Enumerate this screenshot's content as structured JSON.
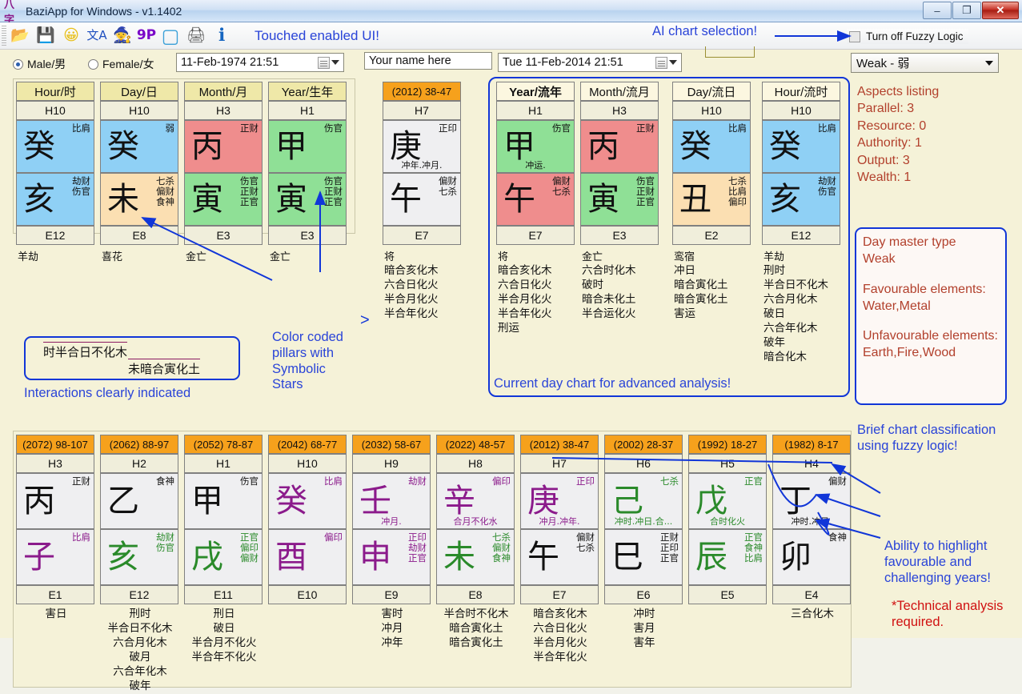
{
  "window": {
    "title": "BaziApp for Windows - v1.1402",
    "app_icon": "bazi-logo-icon",
    "minimize": "–",
    "maximize": "❐",
    "close": "✕"
  },
  "toolbar": {
    "icons": [
      {
        "name": "open-folder-icon",
        "glyph": "📂"
      },
      {
        "name": "save-icon",
        "glyph": "💾"
      },
      {
        "name": "smiley-icon",
        "glyph": "😀"
      },
      {
        "name": "translate-icon",
        "glyph": "文A"
      },
      {
        "name": "wizard-hat-icon",
        "glyph": "🧙"
      },
      {
        "name": "nine-pillars-icon",
        "glyph": "9P"
      },
      {
        "name": "new-window-icon",
        "glyph": "▢"
      },
      {
        "name": "print-icon",
        "glyph": "🖨"
      },
      {
        "name": "info-icon",
        "glyph": "ℹ"
      }
    ],
    "note": "Touched enabled UI!"
  },
  "controls": {
    "male_label": "Male/男",
    "female_label": "Female/女",
    "male_selected": true,
    "birth_datetime": "11-Feb-1974 21:51",
    "name_value": "Your name here",
    "current_datetime": "Tue  11-Feb-2014 21:51",
    "fuzzy_checkbox_label": "Turn off Fuzzy Logic",
    "fuzzy_checked": false,
    "strength_selected": "Weak - 弱",
    "ai_note": "AI chart selection!"
  },
  "natal_pillars": [
    {
      "header": "Hour/时",
      "hnum": "H10",
      "stem": "癸",
      "stem_sub": "比肩",
      "stem_bg": "blue",
      "branch": "亥",
      "branch_sub": "劫财\n伤官",
      "branch_bg": "blue",
      "enum": "E12",
      "star": "羊劫",
      "notes": ""
    },
    {
      "header": "Day/日",
      "hnum": "H10",
      "stem": "癸",
      "stem_sub": "弱",
      "stem_bg": "blue",
      "branch": "未",
      "branch_sub": "七杀\n偏财\n食神",
      "branch_bg": "peach",
      "enum": "E8",
      "star": "喜花",
      "notes": ""
    },
    {
      "header": "Month/月",
      "hnum": "H3",
      "stem": "丙",
      "stem_sub": "正财",
      "stem_bg": "red",
      "branch": "寅",
      "branch_sub": "伤官\n正财\n正官",
      "branch_bg": "green",
      "enum": "E3",
      "star": "金亡",
      "notes": ""
    },
    {
      "header": "Year/生年",
      "hnum": "H1",
      "stem": "甲",
      "stem_sub": "伤官",
      "stem_bg": "green",
      "branch": "寅",
      "branch_sub": "伤官\n正财\n正官",
      "branch_bg": "green",
      "enum": "E3",
      "star": "金亡",
      "notes": ""
    }
  ],
  "current_luck_pillar": {
    "header": "(2012) 38-47",
    "hnum": "H7",
    "stem": "庚",
    "stem_sub": "正印",
    "stem_under": "冲年.冲月.",
    "branch": "午",
    "branch_sub": "偏财\n七杀",
    "enum": "E7",
    "star": "将",
    "notes": "暗合亥化木\n六合日化火\n半合月化火\n半合年化火"
  },
  "current_day_chart": {
    "caption": "Current day chart for advanced analysis!",
    "pillars": [
      {
        "header": "Year/流年",
        "header_bold": true,
        "hnum": "H1",
        "stem": "甲",
        "stem_sub": "伤官",
        "stem_under": "冲运.",
        "stem_bg": "green",
        "branch": "午",
        "branch_sub": "偏财\n七杀",
        "branch_bg": "red",
        "enum": "E7",
        "star": "将",
        "notes": "暗合亥化木\n六合日化火\n半合月化火\n半合年化火\n刑运"
      },
      {
        "header": "Month/流月",
        "hnum": "H3",
        "stem": "丙",
        "stem_sub": "正财",
        "stem_bg": "red",
        "branch": "寅",
        "branch_sub": "伤官\n正财\n正官",
        "branch_bg": "green",
        "enum": "E3",
        "star": "金亡",
        "notes": "六合时化木\n破时\n暗合未化土\n半合运化火"
      },
      {
        "header": "Day/流日",
        "hnum": "H10",
        "stem": "癸",
        "stem_sub": "比肩",
        "stem_bg": "blue",
        "branch": "丑",
        "branch_sub": "七杀\n比肩\n偏印",
        "branch_bg": "peach",
        "enum": "E2",
        "star": "鸾宿",
        "notes": "冲日\n暗合寅化土\n暗合寅化土\n害运"
      },
      {
        "header": "Hour/流时",
        "hnum": "H10",
        "stem": "癸",
        "stem_sub": "比肩",
        "stem_bg": "blue",
        "branch": "亥",
        "branch_sub": "劫财\n伤官",
        "branch_bg": "blue",
        "enum": "E12",
        "star": "羊劫",
        "notes": "刑时\n半合日不化木\n六合月化木\n破日\n六合年化木\n破年\n暗合化木"
      }
    ]
  },
  "interaction_box": {
    "line1": "时半合日不化木",
    "line2": "未暗合寅化土",
    "caption": "Interactions clearly indicated"
  },
  "annotations": {
    "color_coded": "Color coded\npillars with\nSymbolic\nStars",
    "highlight": "Ability to highlight\nfavourable and\nchallenging years!",
    "technical": "*Technical analysis\nrequired.",
    "brief_classification": "Brief chart classification\nusing fuzzy logic!"
  },
  "aspects": {
    "title": "Aspects listing",
    "rows": [
      {
        "label": "Parallel",
        "value": "3"
      },
      {
        "label": "Resource",
        "value": "0"
      },
      {
        "label": "Authority",
        "value": "1"
      },
      {
        "label": "Output",
        "value": "3"
      },
      {
        "label": "Wealth",
        "value": "1"
      }
    ]
  },
  "day_master": {
    "type_label": "Day master type",
    "type_value": "Weak",
    "fav_label": "Favourable elements:",
    "fav_value": "Water,Metal",
    "unfav_label": "Unfavourable elements:",
    "unfav_value": "Earth,Fire,Wood"
  },
  "luck_pillars": [
    {
      "header": "(2072) 98-107",
      "hnum": "H3",
      "stem": "丙",
      "stem_sub": "正财",
      "stem_color": "#111111",
      "branch": "子",
      "branch_sub": "比肩",
      "branch_color": "#8b1a8b",
      "enum": "E1",
      "notes": "害日"
    },
    {
      "header": "(2062) 88-97",
      "hnum": "H2",
      "stem": "乙",
      "stem_sub": "食神",
      "stem_color": "#111111",
      "branch": "亥",
      "branch_sub": "劫财\n伤官",
      "branch_color": "#2a8a2a",
      "enum": "E12",
      "notes": "刑时\n半合日不化木\n六合月化木\n破月\n六合年化木\n破年"
    },
    {
      "header": "(2052) 78-87",
      "hnum": "H1",
      "stem": "甲",
      "stem_sub": "伤官",
      "stem_color": "#111111",
      "branch": "戌",
      "branch_sub": "正官\n偏印\n偏财",
      "branch_color": "#2a8a2a",
      "enum": "E11",
      "notes": "刑日\n破日\n半合月不化火\n半合年不化火"
    },
    {
      "header": "(2042) 68-77",
      "hnum": "H10",
      "stem": "癸",
      "stem_sub": "比肩",
      "stem_color": "#8b1a8b",
      "branch": "酉",
      "branch_sub": "偏印",
      "branch_color": "#8b1a8b",
      "enum": "E10",
      "notes": ""
    },
    {
      "header": "(2032) 58-67",
      "hnum": "H9",
      "stem": "壬",
      "stem_sub": "劫财",
      "stem_under": "冲月.",
      "stem_color": "#8b1a8b",
      "branch": "申",
      "branch_sub": "正印\n劫财\n正官",
      "branch_color": "#8b1a8b",
      "enum": "E9",
      "notes": "害时\n冲月\n冲年"
    },
    {
      "header": "(2022) 48-57",
      "hnum": "H8",
      "stem": "辛",
      "stem_sub": "偏印",
      "stem_under": "合月不化水",
      "stem_color": "#8b1a8b",
      "branch": "未",
      "branch_sub": "七杀\n偏财\n食神",
      "branch_color": "#2a8a2a",
      "enum": "E8",
      "notes": "半合时不化木\n暗合寅化土\n暗合寅化土"
    },
    {
      "header": "(2012) 38-47",
      "hnum": "H7",
      "stem": "庚",
      "stem_sub": "正印",
      "stem_under": "冲月.冲年.",
      "stem_color": "#8b1a8b",
      "branch": "午",
      "branch_sub": "偏财\n七杀",
      "branch_color": "#111111",
      "enum": "E7",
      "notes": "暗合亥化木\n六合日化火\n半合月化火\n半合年化火"
    },
    {
      "header": "(2002) 28-37",
      "hnum": "H6",
      "stem": "己",
      "stem_sub": "七杀",
      "stem_under": "冲时.冲日.合...",
      "stem_color": "#2a8a2a",
      "branch": "巳",
      "branch_sub": "正财\n正印\n正官",
      "branch_color": "#111111",
      "enum": "E6",
      "notes": "冲时\n害月\n害年"
    },
    {
      "header": "(1992) 18-27",
      "hnum": "H5",
      "stem": "戊",
      "stem_sub": "正官",
      "stem_under": "合时化火",
      "stem_color": "#2a8a2a",
      "branch": "辰",
      "branch_sub": "正官\n食神\n比肩",
      "branch_color": "#2a8a2a",
      "enum": "E5",
      "notes": ""
    },
    {
      "header": "(1982) 8-17",
      "hnum": "H4",
      "stem": "丁",
      "stem_sub": "偏财",
      "stem_under": "冲时.冲日.",
      "stem_color": "#111111",
      "branch": "卯",
      "branch_sub": "食神",
      "branch_color": "#111111",
      "enum": "E4",
      "notes": "三合化木"
    }
  ],
  "colors": {
    "panel_bg": "#f5f2d8",
    "blue_cell": "#8fd0f5",
    "green_cell": "#8fe096",
    "red_cell": "#ef8d8d",
    "peach_cell": "#fbdfb2",
    "orange_header": "#f6a11c",
    "yellow_header": "#efe8a8",
    "annotation_blue": "#2a44d8",
    "info_brick": "#b2402c",
    "warning_red": "#d01010"
  }
}
